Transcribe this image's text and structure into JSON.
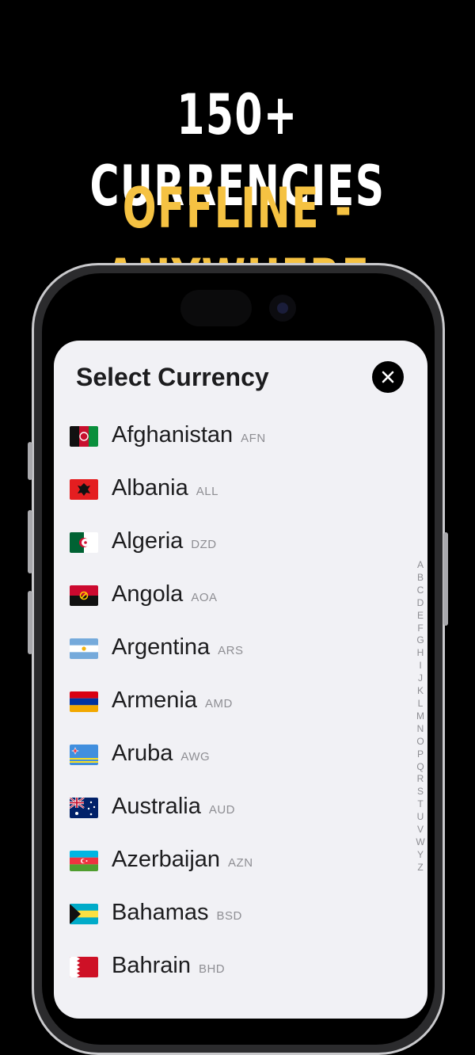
{
  "headline": {
    "line1": "150+ CURRENCIES",
    "line2": "OFFLINE - ANYWHERE"
  },
  "colors": {
    "accent": "#f5c242",
    "sheet_bg": "#f1f1f5"
  },
  "sheet": {
    "title": "Select Currency",
    "close_icon": "close-icon"
  },
  "currencies": [
    {
      "name": "Afghanistan",
      "code": "AFN"
    },
    {
      "name": "Albania",
      "code": "ALL"
    },
    {
      "name": "Algeria",
      "code": "DZD"
    },
    {
      "name": "Angola",
      "code": "AOA"
    },
    {
      "name": "Argentina",
      "code": "ARS"
    },
    {
      "name": "Armenia",
      "code": "AMD"
    },
    {
      "name": "Aruba",
      "code": "AWG"
    },
    {
      "name": "Australia",
      "code": "AUD"
    },
    {
      "name": "Azerbaijan",
      "code": "AZN"
    },
    {
      "name": "Bahamas",
      "code": "BSD"
    },
    {
      "name": "Bahrain",
      "code": "BHD"
    }
  ],
  "index_letters": [
    "A",
    "B",
    "C",
    "D",
    "E",
    "F",
    "G",
    "H",
    "I",
    "J",
    "K",
    "L",
    "M",
    "N",
    "O",
    "P",
    "Q",
    "R",
    "S",
    "T",
    "U",
    "V",
    "W",
    "Y",
    "Z"
  ]
}
